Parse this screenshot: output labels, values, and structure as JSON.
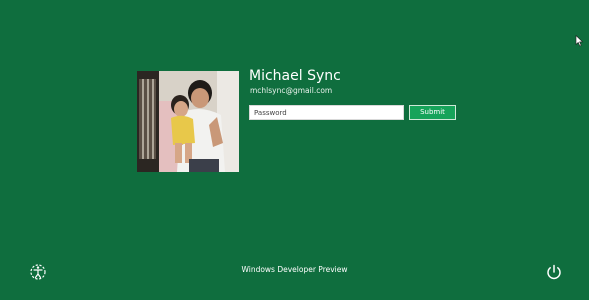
{
  "colors": {
    "background": "#0f6e3e",
    "accent_button": "#16a35a",
    "text": "#ffffff"
  },
  "user": {
    "name": "Michael Sync",
    "email": "mchlsync@gmail.com",
    "avatar_icon": "user-photo"
  },
  "login": {
    "password_placeholder": "Password",
    "password_value": "",
    "submit_label": "Submit"
  },
  "footer": {
    "text": "Windows Developer Preview",
    "ease_of_access_icon": "ease-of-access-icon",
    "power_icon": "power-icon"
  },
  "cursor_icon": "mouse-pointer-icon"
}
